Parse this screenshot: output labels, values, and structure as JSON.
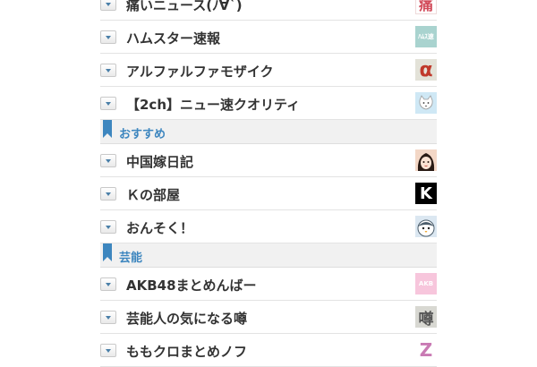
{
  "sections": [
    {
      "items": [
        {
          "label": "痛いニュース(ﾉ∀`)",
          "icon": "itai-news-logo-icon",
          "thumb_text": "痛",
          "thumb_bg": "#ffffff",
          "thumb_color": "#d24b5a"
        },
        {
          "label": "ハムスター速報",
          "icon": "hamster-logo-icon",
          "thumb_text": "ﾊﾑｽ速",
          "thumb_bg": "#a9d3cf",
          "thumb_color": "#ffffff"
        },
        {
          "label": "アルファルファモザイク",
          "icon": "alpha-logo-icon",
          "thumb_text": "α",
          "thumb_bg": "#e3e2d8",
          "thumb_color": "#c0392b"
        },
        {
          "label": "【2ch】ニュー速クオリティ",
          "icon": "cat-logo-icon",
          "thumb_text": "",
          "thumb_bg": "#cfe8f5",
          "thumb_color": "#666666"
        }
      ]
    },
    {
      "header": "おすすめ",
      "items": [
        {
          "label": "中国嫁日記",
          "icon": "chinese-wife-avatar-icon",
          "thumb_text": "",
          "thumb_bg": "#f3d7c6",
          "thumb_color": "#2a1b14"
        },
        {
          "label": "Ｋの部屋",
          "icon": "k-room-logo-icon",
          "thumb_text": "K",
          "thumb_bg": "#000000",
          "thumb_color": "#ffffff"
        },
        {
          "label": "おんそく！",
          "icon": "onsoku-penguin-icon",
          "thumb_text": "",
          "thumb_bg": "#dbe7f1",
          "thumb_color": "#333333"
        }
      ]
    },
    {
      "header": "芸能",
      "items": [
        {
          "label": "AKB48まとめんばー",
          "icon": "akb48-logo-icon",
          "thumb_text": "AKB",
          "thumb_bg": "#f7c6dc",
          "thumb_color": "#ffffff"
        },
        {
          "label": "芸能人の気になる噂",
          "icon": "uwasa-logo-icon",
          "thumb_text": "噂",
          "thumb_bg": "#d8d8d2",
          "thumb_color": "#555555"
        },
        {
          "label": "ももクロまとめノフ",
          "icon": "momoclo-logo-icon",
          "thumb_text": "Z",
          "thumb_bg": "#ffffff",
          "thumb_color": "#c97bb4"
        }
      ]
    }
  ],
  "colors": {
    "header_text": "#3d86bf",
    "header_bg": "#f1f1f1",
    "bookmark": "#3d86bf",
    "toggle_caret": "#4a7fa8"
  }
}
